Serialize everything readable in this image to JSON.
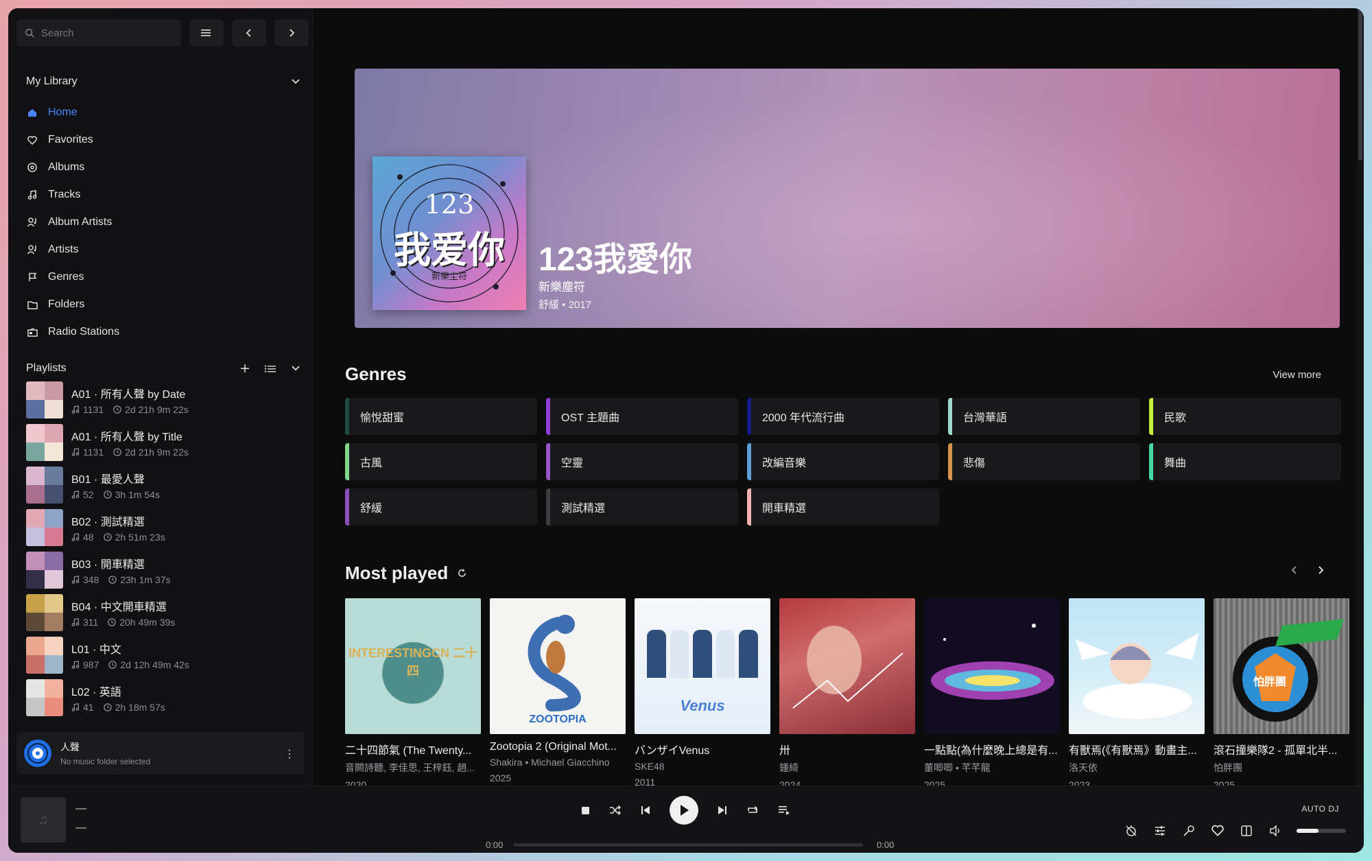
{
  "search": {
    "placeholder": "Search"
  },
  "library": {
    "title": "My Library",
    "items": [
      {
        "label": "Home",
        "icon": "home-icon",
        "active": true
      },
      {
        "label": "Favorites",
        "icon": "heart-icon"
      },
      {
        "label": "Albums",
        "icon": "disc-icon"
      },
      {
        "label": "Tracks",
        "icon": "music-note-icon"
      },
      {
        "label": "Album Artists",
        "icon": "user-music-icon"
      },
      {
        "label": "Artists",
        "icon": "user-music-icon"
      },
      {
        "label": "Genres",
        "icon": "flag-icon"
      },
      {
        "label": "Folders",
        "icon": "folder-icon"
      },
      {
        "label": "Radio Stations",
        "icon": "radio-icon"
      }
    ]
  },
  "playlists": {
    "title": "Playlists",
    "items": [
      {
        "title": "A01 · 所有人聲 by Date",
        "tracks": "1131",
        "duration": "2d 21h 9m 22s"
      },
      {
        "title": "A01 · 所有人聲 by Title",
        "tracks": "1131",
        "duration": "2d 21h 9m 22s"
      },
      {
        "title": "B01 · 最愛人聲",
        "tracks": "52",
        "duration": "3h 1m 54s"
      },
      {
        "title": "B02 · 測試精選",
        "tracks": "48",
        "duration": "2h 51m 23s"
      },
      {
        "title": "B03 · 開車精選",
        "tracks": "348",
        "duration": "23h 1m 37s"
      },
      {
        "title": "B04 · 中文開車精選",
        "tracks": "311",
        "duration": "20h 49m 39s"
      },
      {
        "title": "L01 · 中文",
        "tracks": "987",
        "duration": "2d 12h 49m 42s"
      },
      {
        "title": "L02 · 英語",
        "tracks": "41",
        "duration": "2h 18m 57s"
      }
    ]
  },
  "library_card": {
    "name": "人聲",
    "status": "No music folder selected"
  },
  "hero": {
    "title": "123我愛你",
    "artist": "新樂塵符",
    "meta": "舒緩 • 2017",
    "cover_line1": "123",
    "cover_line2": "我爱你",
    "cover_line3": "新樂尘符"
  },
  "genres": {
    "title": "Genres",
    "view_more": "View more",
    "items": [
      {
        "label": "愉悅甜蜜",
        "color": "#1f4a44"
      },
      {
        "label": "OST 主題曲",
        "color": "#8f3fd6"
      },
      {
        "label": "2000 年代流行曲",
        "color": "#151a8a"
      },
      {
        "label": "台灣華語",
        "color": "#9fd8d2"
      },
      {
        "label": "民歌",
        "color": "#c4ee3c"
      },
      {
        "label": "古風",
        "color": "#7fd88a"
      },
      {
        "label": "空靈",
        "color": "#9a55c6"
      },
      {
        "label": "改編音樂",
        "color": "#5b9ed6"
      },
      {
        "label": "悲傷",
        "color": "#d6924c"
      },
      {
        "label": "舞曲",
        "color": "#46d6a0"
      },
      {
        "label": "舒緩",
        "color": "#8a4fb8"
      },
      {
        "label": "測試精選",
        "color": "#3e3e42"
      },
      {
        "label": "開車精選",
        "color": "#f2b3b3"
      }
    ]
  },
  "most_played": {
    "title": "Most played",
    "items": [
      {
        "title": "二十四節氣 (The Twenty...",
        "artist": "音闕詩聽, 李佳思, 王梓鈺, 趙...",
        "year": "2020",
        "cover_text": "INTERESTINGCN 二十四"
      },
      {
        "title": "Zootopia 2 (Original Mot...",
        "artist": "Shakira • Michael Giacchino",
        "year": "2025",
        "cover_text": "ZOOTOPIA"
      },
      {
        "title": "バンザイVenus",
        "artist": "SKE48",
        "year": "2011",
        "cover_text": "Venus"
      },
      {
        "title": "卅",
        "artist": "鍾綺",
        "year": "2024",
        "cover_text": ""
      },
      {
        "title": "一點點(為什麼晚上總是有...",
        "artist": "董唧唧 • 芊芊龍",
        "year": "2025",
        "cover_text": ""
      },
      {
        "title": "有獸焉(《有獸焉》動畫主...",
        "artist": "洛天依",
        "year": "2023",
        "cover_text": ""
      },
      {
        "title": "滾石撞樂隊2 - 孤單北半...",
        "artist": "怕胖團",
        "year": "2025",
        "cover_text": "怕胖團"
      }
    ]
  },
  "player": {
    "title": "—",
    "artist": "—",
    "time_current": "0:00",
    "time_total": "0:00",
    "auto_dj": "AUTO DJ",
    "volume": 0.45
  },
  "colors": {
    "accent": "#4b86ff",
    "background": "#0c0c0d",
    "sidebar": "#111113"
  }
}
